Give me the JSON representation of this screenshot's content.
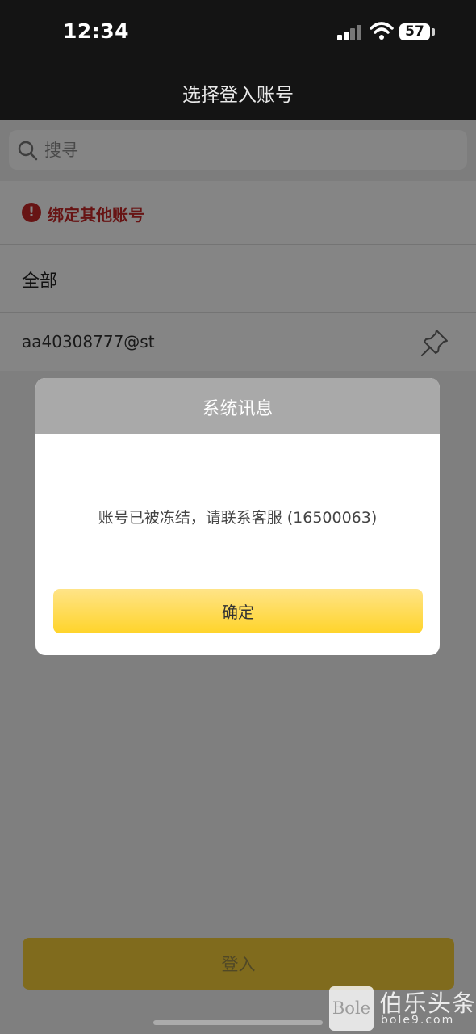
{
  "status_bar": {
    "time": "12:34",
    "battery": "57"
  },
  "nav": {
    "title": "选择登入账号"
  },
  "search": {
    "placeholder": "搜寻"
  },
  "list": {
    "bind_other_label": "绑定其他账号",
    "all_label": "全部",
    "account_label": "aa40308777@st"
  },
  "login_button_label": "登入",
  "dialog": {
    "title": "系统讯息",
    "message": "账号已被冻结，请联系客服 (16500063)",
    "confirm_label": "确定"
  },
  "watermark": {
    "logo_text": "Bole",
    "name": "伯乐头条",
    "url": "bole9.com"
  },
  "colors": {
    "accent_yellow": "#ffd42a",
    "alert_red": "#c62828",
    "header_dark": "#141414"
  }
}
